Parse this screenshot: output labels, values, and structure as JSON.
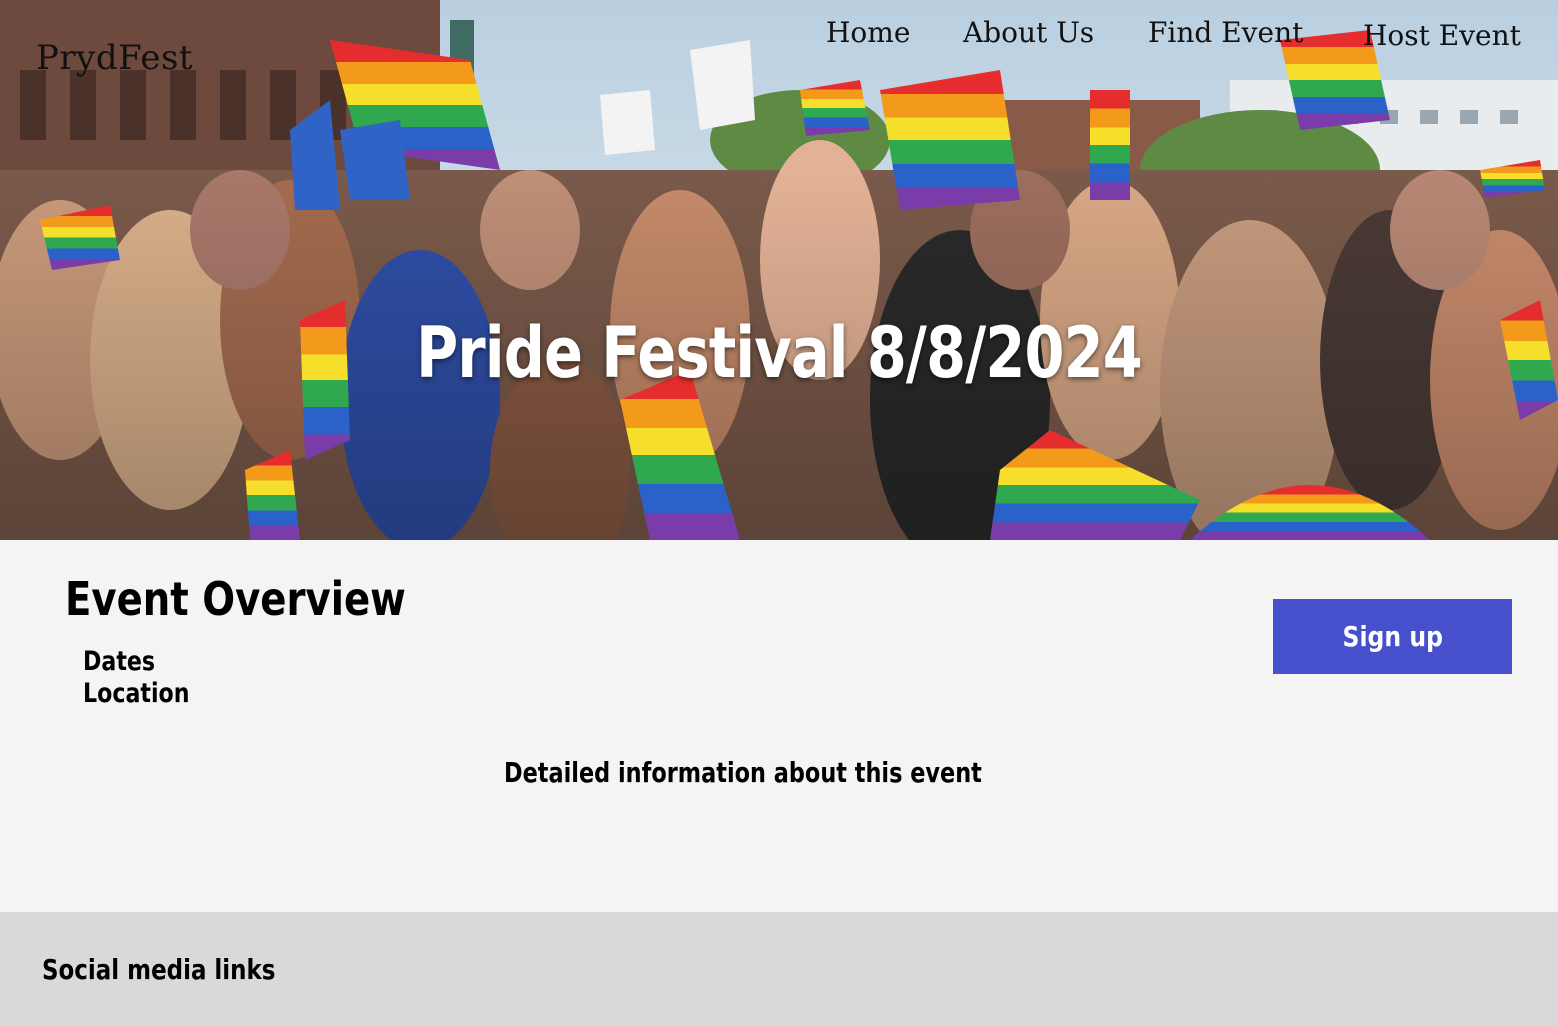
{
  "header": {
    "brand": "PrydFest",
    "nav": [
      "Home",
      "About Us",
      "Find Event",
      "Host Event"
    ]
  },
  "hero": {
    "title": "Pride Festival 8/8/2024",
    "image": "crowd-with-rainbow-flags"
  },
  "overview": {
    "title": "Event Overview",
    "dates_label": "Dates",
    "location_label": "Location",
    "signup_label": "Sign up",
    "detail_text": "Detailed information about this event"
  },
  "footer": {
    "social_label": "Social media links"
  },
  "colors": {
    "accent": "#4650cc",
    "page_bg": "#f4f4f4",
    "footer_bg": "#d9d9d9"
  }
}
